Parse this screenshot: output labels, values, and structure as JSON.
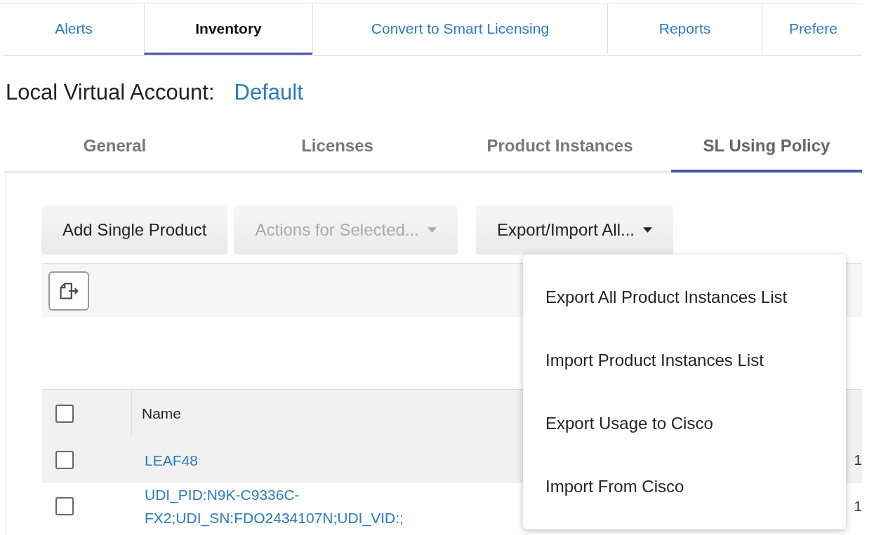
{
  "nav_tabs": [
    {
      "label": "Alerts",
      "selected": false
    },
    {
      "label": "Inventory",
      "selected": true
    },
    {
      "label": "Convert to Smart Licensing",
      "selected": false
    },
    {
      "label": "Reports",
      "selected": false
    },
    {
      "label": "Prefere",
      "selected": false
    }
  ],
  "account": {
    "label": "Local Virtual Account:",
    "value": "Default"
  },
  "sub_tabs": [
    {
      "label": "General",
      "selected": false
    },
    {
      "label": "Licenses",
      "selected": false
    },
    {
      "label": "Product Instances",
      "selected": false
    },
    {
      "label": "SL Using Policy",
      "selected": true
    }
  ],
  "buttons": [
    {
      "label": "Add Single Product",
      "kind": "button",
      "disabled": false
    },
    {
      "label": "Actions for Selected...",
      "kind": "dropdown",
      "disabled": true
    },
    {
      "label": "Export/Import All...",
      "kind": "dropdown",
      "disabled": false
    }
  ],
  "dropdown": {
    "items": [
      "Export All Product Instances List",
      "Import Product Instances List",
      "Export Usage to Cisco",
      "Import From Cisco"
    ]
  },
  "table": {
    "columns": [
      "Name"
    ],
    "header_checked": false,
    "rows": [
      {
        "name": "LEAF48",
        "checked": false,
        "column_3": "1"
      },
      {
        "name": "UDI_PID:N9K-C9336C-FX2;UDI_SN:FDO2434107N;UDI_VID:;",
        "checked": false,
        "column_3": "1"
      }
    ]
  }
}
